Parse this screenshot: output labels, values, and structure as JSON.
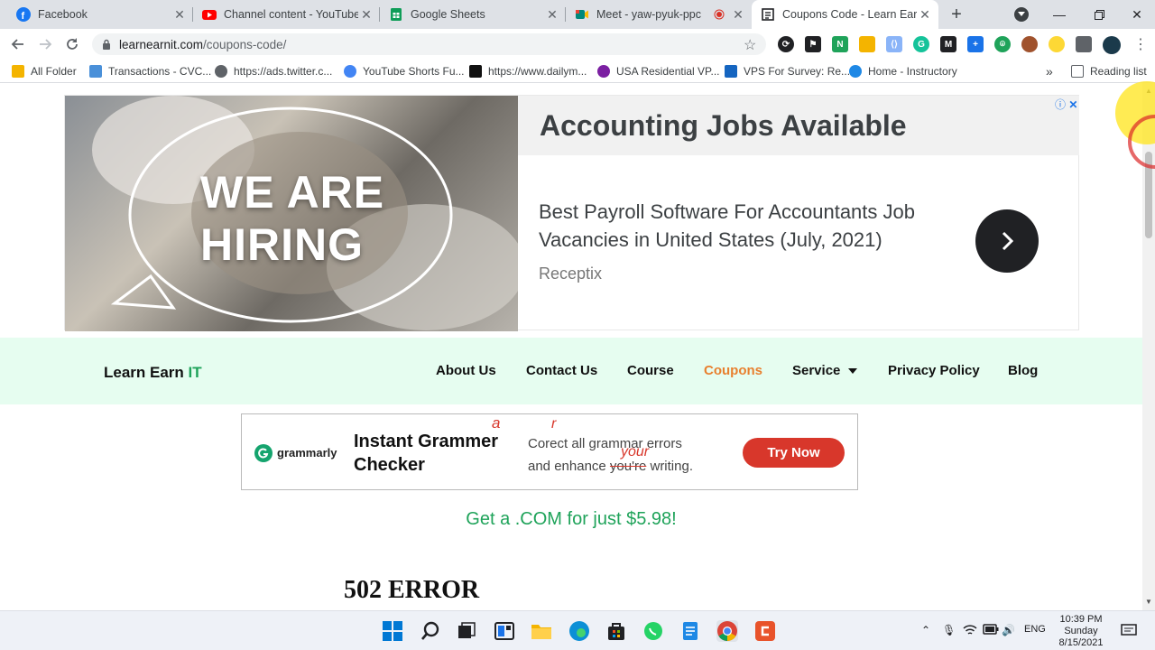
{
  "browser": {
    "tabs": [
      {
        "title": "Facebook",
        "icon": "facebook-icon",
        "color": "#1877f2"
      },
      {
        "title": "Channel content - YouTube S",
        "icon": "youtube-icon",
        "color": "#ff0000"
      },
      {
        "title": "Google Sheets",
        "icon": "sheets-icon",
        "color": "#0f9d58"
      },
      {
        "title": "Meet - yaw-pyuk-ppc",
        "icon": "meet-icon",
        "color": "#00897b"
      },
      {
        "title": "Coupons Code - Learn Earn I",
        "icon": "page-icon",
        "color": "#202124"
      }
    ],
    "url_domain": "learnearnit.com",
    "url_path": "/coupons-code/",
    "bookmarks": [
      {
        "label": "All Folder",
        "color": "#f4b400"
      },
      {
        "label": "Transactions - CVC...",
        "color": "#4a90d9"
      },
      {
        "label": "https://ads.twitter.c...",
        "color": "#5f6368"
      },
      {
        "label": "YouTube Shorts Fu...",
        "color": "#4285f4"
      },
      {
        "label": "https://www.dailym...",
        "color": "#111111"
      },
      {
        "label": "USA Residential VP...",
        "color": "#7b1fa2"
      },
      {
        "label": "VPS For Survey: Re...",
        "color": "#1565c0"
      },
      {
        "label": "Home - Instructory",
        "color": "#1e88e5"
      }
    ],
    "reading_list": "Reading list",
    "more_bookmarks": "»"
  },
  "ad_banner": {
    "image_text_line1": "WE ARE",
    "image_text_line2": "HIRING",
    "title": "Accounting Jobs Available",
    "description": "Best Payroll Software For Accountants Job Vacancies in United States (July, 2021)",
    "advertiser": "Receptix"
  },
  "site_nav": {
    "brand_main": "Learn Earn ",
    "brand_accent": "IT",
    "items": [
      {
        "label": "About Us"
      },
      {
        "label": "Contact Us"
      },
      {
        "label": "Course"
      },
      {
        "label": "Coupons",
        "active": true
      },
      {
        "label": "Service"
      },
      {
        "label": "Privacy Policy"
      },
      {
        "label": "Blog"
      }
    ],
    "accent_color": "#e8802f"
  },
  "grammarly_ad": {
    "brand": "grammarly",
    "headline_line1": "Instant Grammer",
    "headline_line2": "Checker",
    "body_line1": "Corect all grammar errors",
    "body_line2_start": "and enhance ",
    "body_line2_strike": "you're",
    "body_line2_end": " writing.",
    "correction_a": "a",
    "correction_r": "r",
    "correction_your": "your",
    "button": "Try Now"
  },
  "promo_text": "Get a .COM for just $5.98!",
  "error_heading": "502 ERROR",
  "taskbar": {
    "language": "ENG",
    "time": "10:39 PM",
    "day": "Sunday",
    "date": "8/15/2021"
  }
}
